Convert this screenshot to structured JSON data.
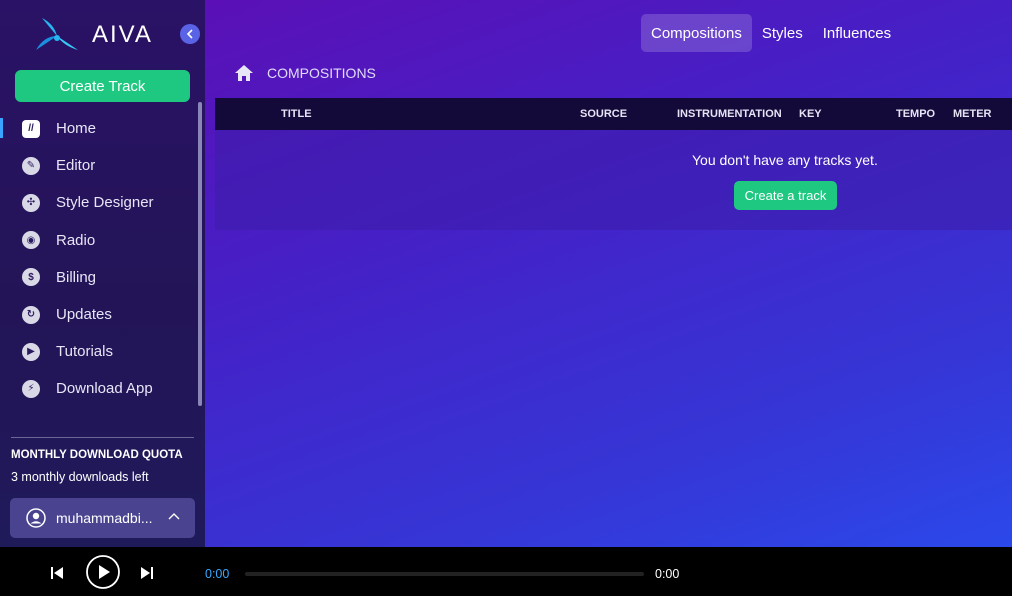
{
  "brand": {
    "name": "AIVA"
  },
  "sidebar": {
    "create_label": "Create Track",
    "items": [
      {
        "label": "Home",
        "icon": "home-logo-icon"
      },
      {
        "label": "Editor",
        "icon": "pencil-icon"
      },
      {
        "label": "Style Designer",
        "icon": "fan-icon"
      },
      {
        "label": "Radio",
        "icon": "radio-icon"
      },
      {
        "label": "Billing",
        "icon": "dollar-icon"
      },
      {
        "label": "Updates",
        "icon": "refresh-icon"
      },
      {
        "label": "Tutorials",
        "icon": "play-icon"
      },
      {
        "label": "Download App",
        "icon": "download-icon"
      }
    ],
    "quota_title": "MONTHLY DOWNLOAD QUOTA",
    "quota_text": "3 monthly downloads left",
    "username": "muhammadbi..."
  },
  "header": {
    "tabs": [
      {
        "label": "Compositions",
        "active": true
      },
      {
        "label": "Styles",
        "active": false
      },
      {
        "label": "Influences",
        "active": false
      }
    ],
    "breadcrumb": "COMPOSITIONS"
  },
  "table": {
    "columns": [
      "TITLE",
      "SOURCE",
      "INSTRUMENTATION",
      "KEY",
      "TEMPO",
      "METER"
    ],
    "empty_message": "You don't have any tracks yet.",
    "create_label": "Create a track"
  },
  "player": {
    "current_time": "0:00",
    "total_time": "0:00",
    "progress": 0
  },
  "colors": {
    "accent_green": "#1ec880",
    "active_blue": "#3aa4ff",
    "sidebar_bg": "#231457"
  }
}
